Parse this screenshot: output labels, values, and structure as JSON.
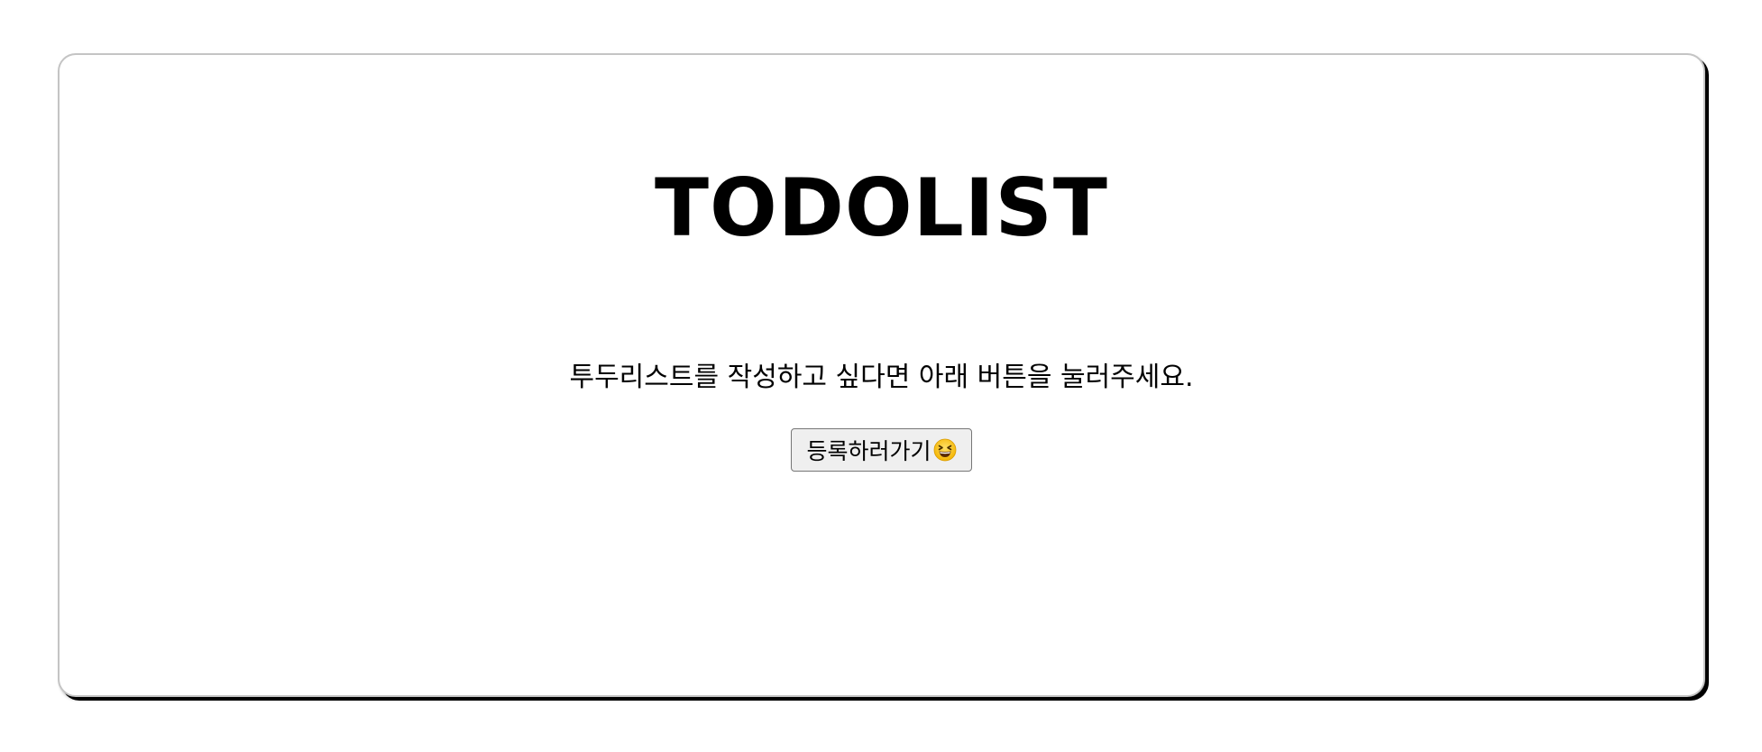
{
  "page": {
    "title": "TODOLIST",
    "description": "투두리스트를 작성하고 싶다면 아래 버튼을 눌러주세요.",
    "register_button_label": "등록하러가기",
    "register_button_icon": "grinning-squinting-face-icon"
  },
  "colors": {
    "background": "#ffffff",
    "card_border": "#c4c4c4",
    "card_shadow": "#000000",
    "button_background": "#efefef",
    "button_border": "#767676",
    "text": "#000000"
  }
}
